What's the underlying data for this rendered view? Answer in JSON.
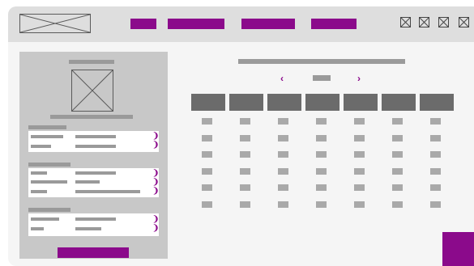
{
  "header": {
    "logo_icon": "image-placeholder-icon",
    "nav_items": [
      "",
      "",
      "",
      ""
    ],
    "window_controls": [
      "close-box-icon",
      "close-box-icon",
      "close-box-icon",
      "close-box-icon"
    ]
  },
  "sidebar": {
    "avatar_icon": "image-placeholder-icon",
    "cards": [
      {
        "rows": 2
      },
      {
        "rows": 3
      },
      {
        "rows": 2
      }
    ],
    "button_label": ""
  },
  "calendar": {
    "title": "",
    "prev_icon": "‹",
    "next_icon": "›",
    "period_label": "",
    "columns": 7,
    "rows": 6
  },
  "accent_color": "#8b0a8b"
}
